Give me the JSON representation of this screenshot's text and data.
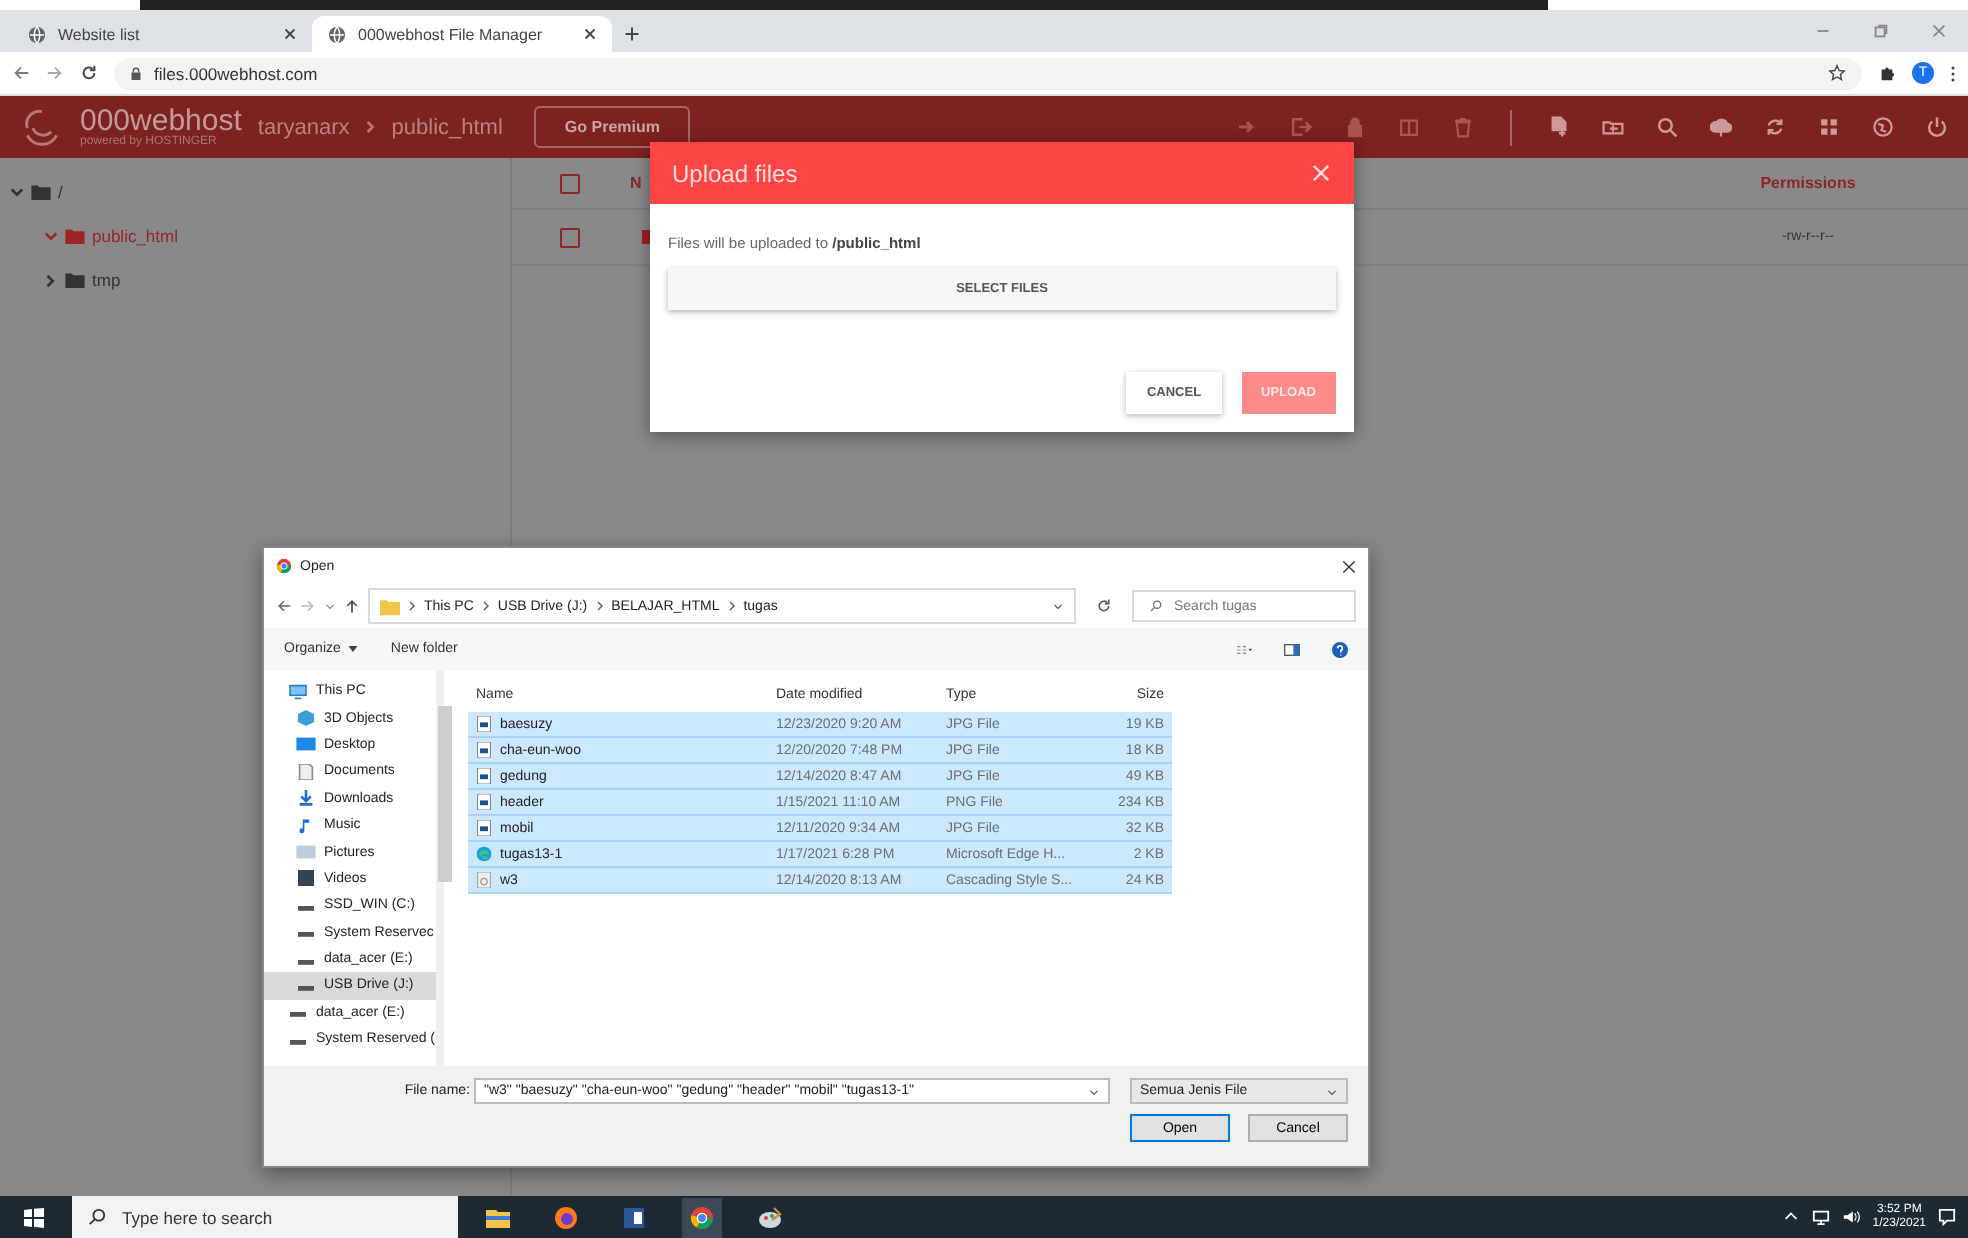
{
  "browser": {
    "tabs": [
      {
        "label": "Website list",
        "selected": false
      },
      {
        "label": "000webhost File Manager",
        "selected": true
      }
    ],
    "url": "files.000webhost.com",
    "avatar": "T"
  },
  "app": {
    "logo": "000webhost",
    "logo_sub": "powered by HOSTINGER",
    "breadcrumb": [
      "taryanarx",
      "public_html"
    ],
    "premium_button": "Go Premium",
    "tree": [
      {
        "label": "/",
        "expanded": true,
        "selected": false,
        "children": [
          {
            "label": "public_html",
            "expanded": true,
            "selected": true
          },
          {
            "label": "tmp",
            "expanded": false,
            "selected": false
          }
        ]
      }
    ],
    "table": {
      "select_all_checked": false,
      "columns": [
        "N",
        "Permissions"
      ],
      "rows": [
        {
          "checked": false,
          "permissions": "-rw-r--r--"
        }
      ]
    }
  },
  "upload_modal": {
    "title": "Upload files",
    "message": "Files will be uploaded to **/public_html**",
    "select_button": "SELECT FILES",
    "cancel_button": "CANCEL",
    "upload_button": {
      "label": "UPLOAD",
      "disabled": true
    }
  },
  "open_dialog": {
    "title": "Open",
    "path": [
      "This PC",
      "USB Drive (J:)",
      "BELAJAR_HTML",
      "tugas"
    ],
    "search_placeholder": "Search tugas",
    "organize": "Organize",
    "new_folder": "New folder",
    "nav": [
      {
        "label": "This PC",
        "kind": "pc",
        "selected": false,
        "children": [
          {
            "label": "3D Objects",
            "kind": "objects",
            "selected": false
          },
          {
            "label": "Desktop",
            "kind": "desktop",
            "selected": false
          },
          {
            "label": "Documents",
            "kind": "documents",
            "selected": false
          },
          {
            "label": "Downloads",
            "kind": "downloads",
            "selected": false
          },
          {
            "label": "Music",
            "kind": "music",
            "selected": false
          },
          {
            "label": "Pictures",
            "kind": "pictures",
            "selected": false
          },
          {
            "label": "Videos",
            "kind": "videos",
            "selected": false
          },
          {
            "label": "SSD_WIN (C:)",
            "kind": "drive",
            "selected": false
          },
          {
            "label": "System Reservec",
            "kind": "drive",
            "selected": false
          },
          {
            "label": "data_acer (E:)",
            "kind": "drive",
            "selected": false
          },
          {
            "label": "USB Drive (J:)",
            "kind": "drive",
            "selected": true
          }
        ]
      },
      {
        "label": "data_acer (E:)",
        "kind": "drive",
        "selected": false
      },
      {
        "label": "System Reserved (",
        "kind": "drive",
        "selected": false
      }
    ],
    "columns": [
      "Name",
      "Date modified",
      "Type",
      "Size"
    ],
    "files": [
      {
        "name": "baesuzy",
        "date": "12/23/2020 9:20 AM",
        "type": "JPG File",
        "size": "19 KB",
        "kind": "image",
        "selected": true
      },
      {
        "name": "cha-eun-woo",
        "date": "12/20/2020 7:48 PM",
        "type": "JPG File",
        "size": "18 KB",
        "kind": "image",
        "selected": true
      },
      {
        "name": "gedung",
        "date": "12/14/2020 8:47 AM",
        "type": "JPG File",
        "size": "49 KB",
        "kind": "image",
        "selected": true
      },
      {
        "name": "header",
        "date": "1/15/2021 11:10 AM",
        "type": "PNG File",
        "size": "234 KB",
        "kind": "image",
        "selected": true
      },
      {
        "name": "mobil",
        "date": "12/11/2020 9:34 AM",
        "type": "JPG File",
        "size": "32 KB",
        "kind": "image",
        "selected": true
      },
      {
        "name": "tugas13-1",
        "date": "1/17/2021 6:28 PM",
        "type": "Microsoft Edge H...",
        "size": "2 KB",
        "kind": "html",
        "selected": true
      },
      {
        "name": "w3",
        "date": "12/14/2020 8:13 AM",
        "type": "Cascading Style S...",
        "size": "24 KB",
        "kind": "css",
        "selected": true
      }
    ],
    "filename_label": "File name:",
    "filename_value": "\"w3\" \"baesuzy\" \"cha-eun-woo\" \"gedung\" \"header\" \"mobil\" \"tugas13-1\"",
    "file_type": "Semua Jenis File",
    "open_button": "Open",
    "cancel_button": "Cancel"
  },
  "taskbar": {
    "search_placeholder": "Type here to search",
    "time": "3:52 PM",
    "date": "1/23/2021"
  }
}
